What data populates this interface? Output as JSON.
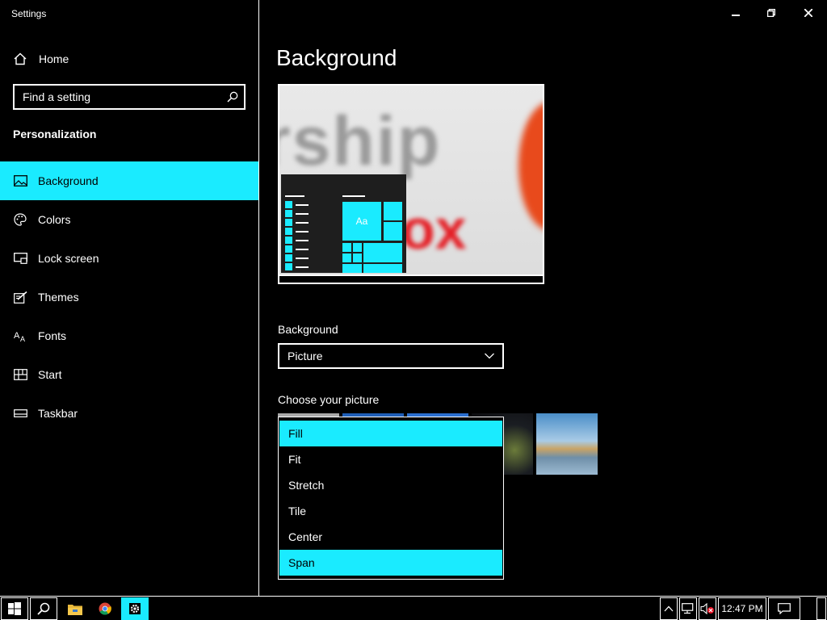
{
  "window": {
    "title": "Settings"
  },
  "sidebar": {
    "home_label": "Home",
    "search_placeholder": "Find a setting",
    "section_title": "Personalization",
    "items": [
      {
        "label": "Background",
        "icon": "picture-icon",
        "active": true
      },
      {
        "label": "Colors",
        "icon": "palette-icon",
        "active": false
      },
      {
        "label": "Lock screen",
        "icon": "lock-screen-icon",
        "active": false
      },
      {
        "label": "Themes",
        "icon": "brush-icon",
        "active": false
      },
      {
        "label": "Fonts",
        "icon": "font-icon",
        "active": false
      },
      {
        "label": "Start",
        "icon": "start-icon",
        "active": false
      },
      {
        "label": "Taskbar",
        "icon": "taskbar-icon",
        "active": false
      }
    ]
  },
  "main": {
    "page_title": "Background",
    "preview": {
      "sample_tile_text": "Aa"
    },
    "background_label": "Background",
    "background_value": "Picture",
    "choose_picture_label": "Choose your picture",
    "fit_options": [
      "Fill",
      "Fit",
      "Stretch",
      "Tile",
      "Center",
      "Span"
    ],
    "fit_highlighted": [
      "Fill",
      "Span"
    ]
  },
  "taskbar": {
    "clock": "12:47 PM",
    "apps": [
      "start-icon",
      "search-icon",
      "file-explorer-icon",
      "chrome-icon",
      "settings-icon"
    ]
  },
  "colors": {
    "accent": "#1aebff",
    "background": "#000000",
    "foreground": "#ffffff"
  }
}
